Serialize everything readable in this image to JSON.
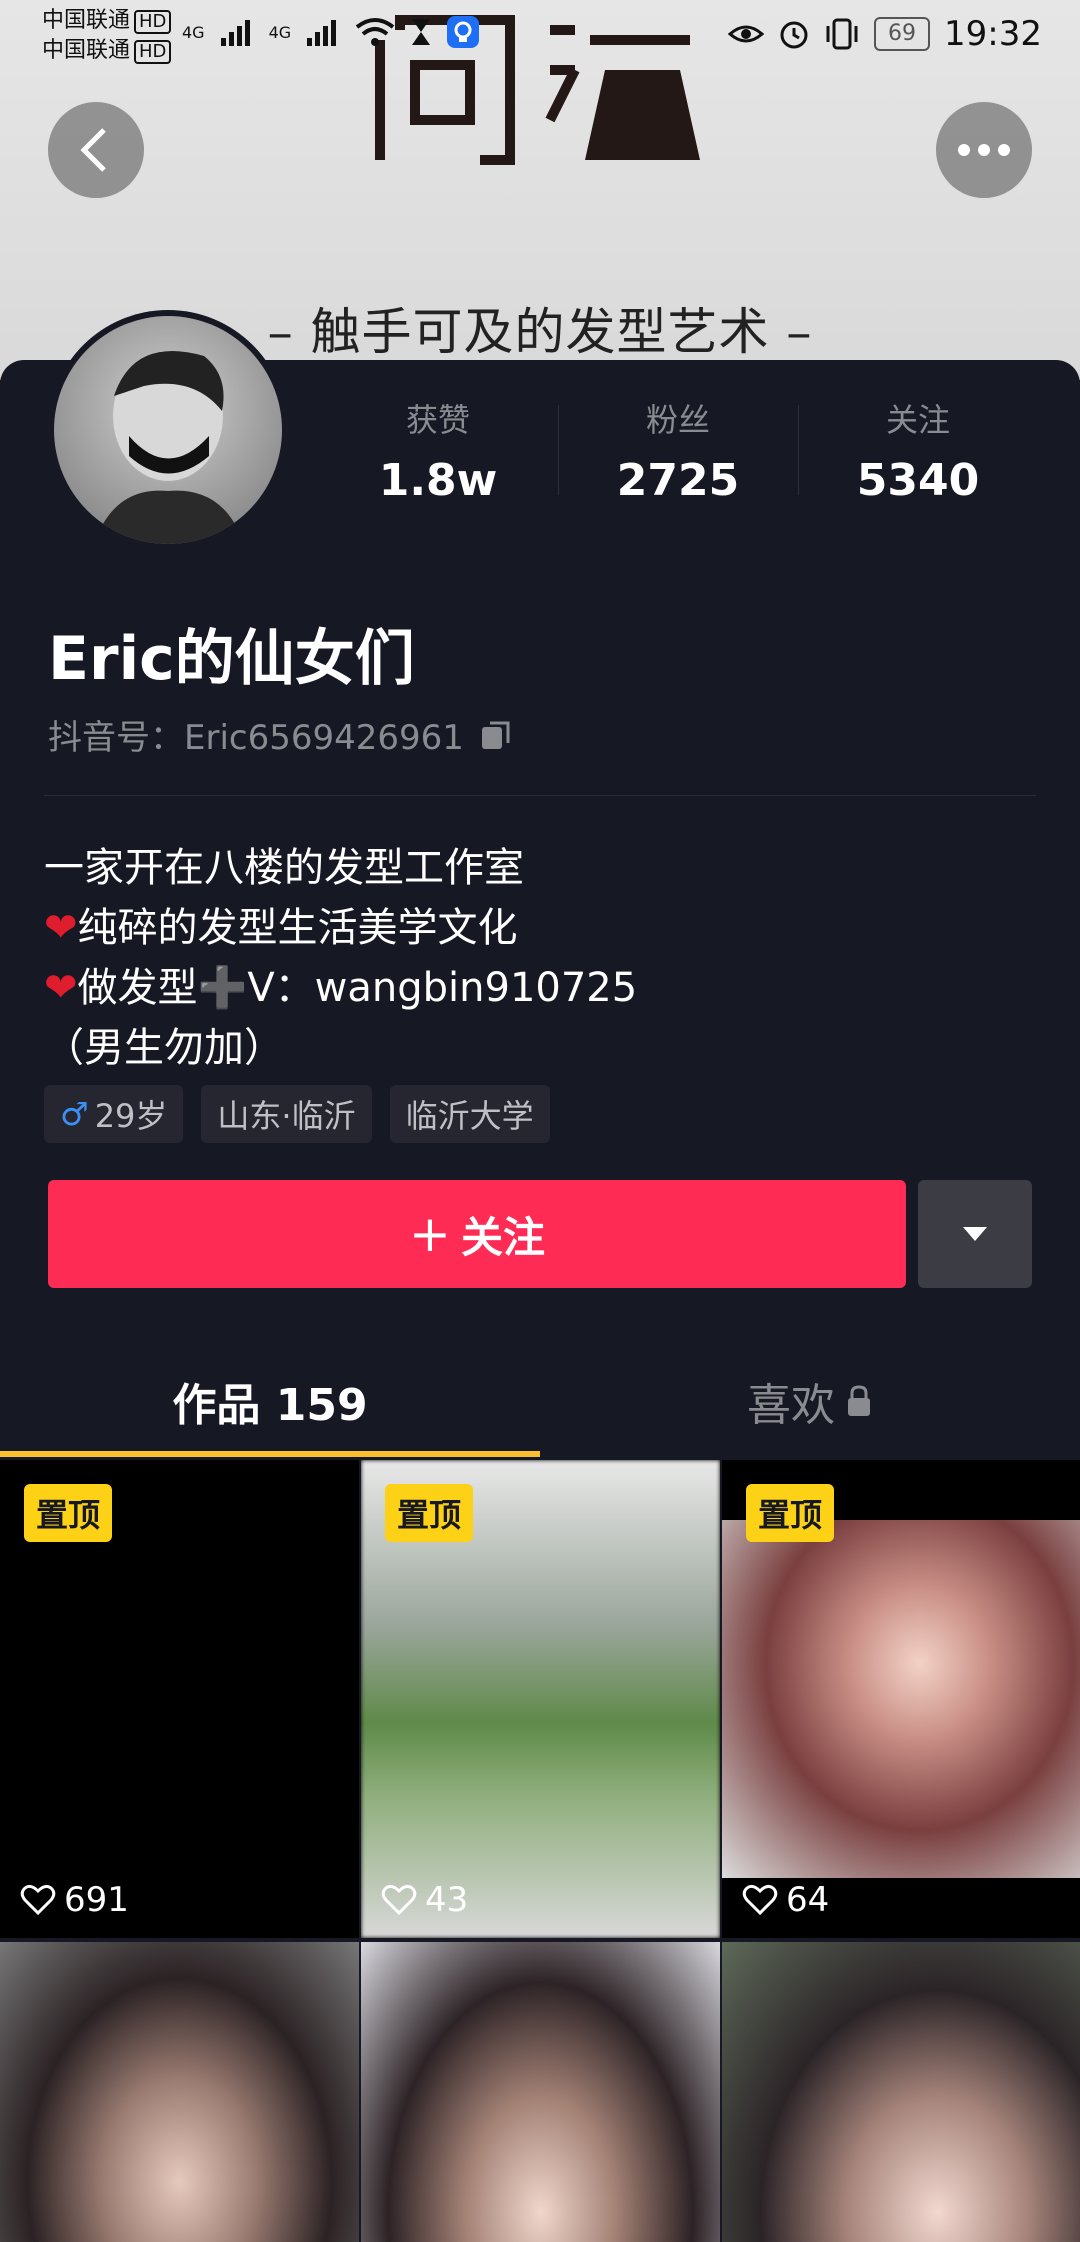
{
  "statusbar": {
    "carrier1": "中国联通",
    "carrier2": "中国联通",
    "hd": "HD",
    "network": "4G",
    "battery": "69",
    "time": "19:32"
  },
  "banner": {
    "tagline": "– 触手可及的发型艺术 –"
  },
  "stats": [
    {
      "label": "获赞",
      "value": "1.8w"
    },
    {
      "label": "粉丝",
      "value": "2725"
    },
    {
      "label": "关注",
      "value": "5340"
    }
  ],
  "profile": {
    "name": "Eric的仙女们",
    "uid_label": "抖音号：",
    "uid": "Eric6569426961",
    "bio": {
      "line1": "一家开在八楼的发型工作室",
      "line2": "纯碎的发型生活美学文化",
      "line3": "做发型➕V：wangbin910725",
      "line4": "（男生勿加）"
    },
    "tags": {
      "age": "29岁",
      "location": "山东·临沂",
      "school": "临沂大学"
    }
  },
  "actions": {
    "follow": "关注",
    "follow_color": "#fe2c55"
  },
  "tabs": {
    "works": "作品 159",
    "likes": "喜欢"
  },
  "videos": [
    {
      "pinned": "置顶",
      "likes": "691"
    },
    {
      "pinned": "置顶",
      "likes": "43"
    },
    {
      "pinned": "置顶",
      "likes": "64"
    },
    {},
    {},
    {}
  ]
}
